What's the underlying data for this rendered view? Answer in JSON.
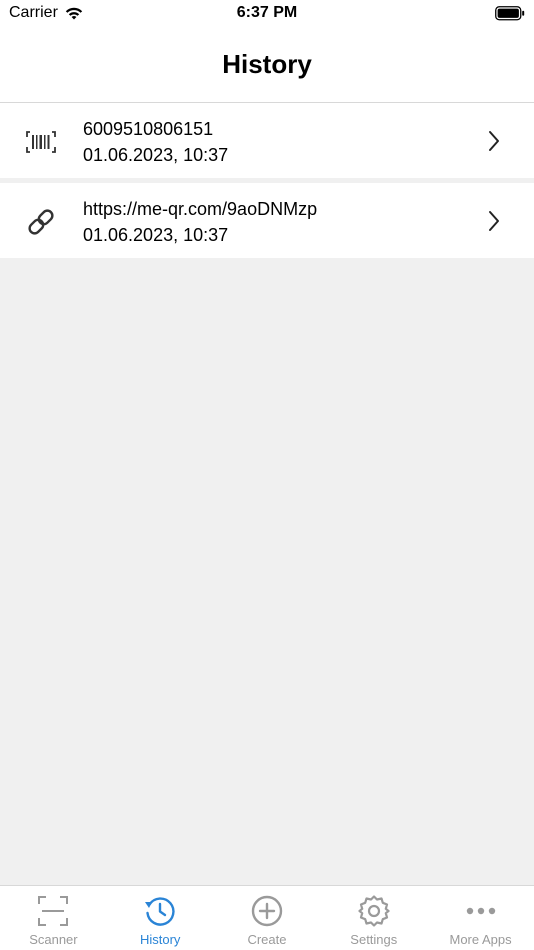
{
  "status_bar": {
    "carrier": "Carrier",
    "time": "6:37 PM"
  },
  "nav": {
    "title": "History"
  },
  "history": [
    {
      "icon": "barcode-icon",
      "title": "6009510806151",
      "date": "01.06.2023, 10:37"
    },
    {
      "icon": "link-icon",
      "title": "https://me-qr.com/9aoDNMzp",
      "date": "01.06.2023, 10:37"
    }
  ],
  "tabs": [
    {
      "label": "Scanner",
      "icon": "scan-frame-icon",
      "active": false
    },
    {
      "label": "History",
      "icon": "history-clock-icon",
      "active": true
    },
    {
      "label": "Create",
      "icon": "plus-circle-icon",
      "active": false
    },
    {
      "label": "Settings",
      "icon": "gear-icon",
      "active": false
    },
    {
      "label": "More Apps",
      "icon": "ellipsis-icon",
      "active": false
    }
  ],
  "colors": {
    "accent": "#2a84d6",
    "inactive": "#9a9a9a",
    "background": "#f0f0f0"
  }
}
